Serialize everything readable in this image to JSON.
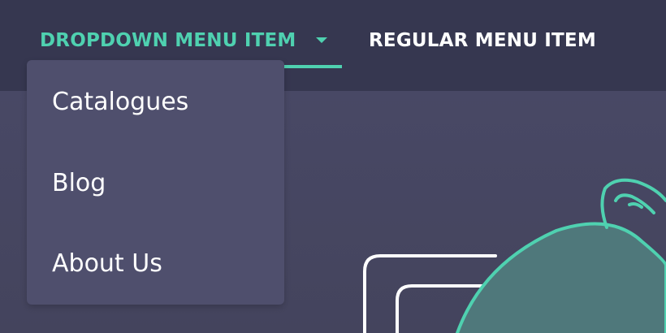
{
  "colors": {
    "accent": "#4fd1b0",
    "nav_bg": "#363750",
    "menu_bg": "#4f4f6d",
    "hero_bg": "#45455f",
    "illustration_fill": "#4f787b",
    "outline_white": "#ffffff"
  },
  "nav": {
    "dropdown_label": "DROPDOWN MENU ITEM",
    "regular_label": "REGULAR MENU ITEM",
    "dropdown_icon": "caret-down-icon"
  },
  "dropdown": {
    "items": [
      {
        "label": "Catalogues"
      },
      {
        "label": "Blog"
      },
      {
        "label": "About Us"
      }
    ]
  },
  "hero": {
    "illustration": "teal-bag-illustration"
  }
}
